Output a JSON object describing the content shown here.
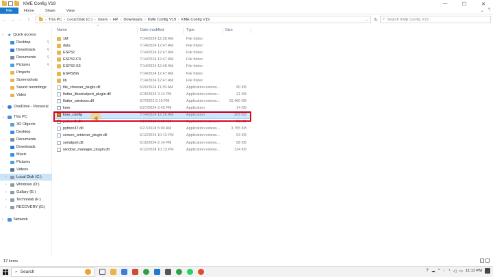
{
  "window": {
    "title": "KME Config V19",
    "controls": {
      "minimize": "—",
      "maximize": "☐",
      "close": "✕"
    }
  },
  "ribbon": {
    "tabs": [
      "File",
      "Home",
      "Share",
      "View"
    ],
    "right_icons": [
      "chevron-down-icon",
      "help-icon"
    ]
  },
  "address": {
    "crumbs": [
      "This PC",
      "Local Disk (C:)",
      "Users",
      "HP",
      "Downloads",
      "KME Config V19",
      "KME Config V19"
    ],
    "search_placeholder": "Search KME Config V19"
  },
  "nav": {
    "quick_access": "Quick access",
    "quick_items": [
      "Desktop",
      "Downloads",
      "Documents",
      "Pictures",
      "Projects",
      "Screenshots",
      "Sound recordings",
      "Video"
    ],
    "onedrive": "OneDrive - Personal",
    "this_pc": "This PC",
    "pc_items": [
      "3D Objects",
      "Desktop",
      "Documents",
      "Downloads",
      "Music",
      "Pictures",
      "Videos",
      "Local Disk (C:)",
      "Windows (D:)",
      "Gallary (E:)",
      "Technolab (F:)",
      "RECOVERY (G:)"
    ],
    "network": "Network"
  },
  "columns": {
    "name": "Name",
    "date": "Date modified",
    "type": "Type",
    "size": "Size"
  },
  "files": [
    {
      "name": "1M",
      "date": "7/14/2024 12:28 AM",
      "type": "File folder",
      "size": "",
      "kind": "folder"
    },
    {
      "name": "data",
      "date": "7/14/2024 12:47 AM",
      "type": "File folder",
      "size": "",
      "kind": "folder"
    },
    {
      "name": "ESP32",
      "date": "7/14/2024 12:47 AM",
      "type": "File folder",
      "size": "",
      "kind": "folder"
    },
    {
      "name": "ESP32-C3",
      "date": "7/14/2024 12:47 AM",
      "type": "File folder",
      "size": "",
      "kind": "folder"
    },
    {
      "name": "ESP32-S3",
      "date": "7/14/2024 12:48 AM",
      "type": "File folder",
      "size": "",
      "kind": "folder"
    },
    {
      "name": "ESP8266",
      "date": "7/14/2024 12:47 AM",
      "type": "File folder",
      "size": "",
      "kind": "folder"
    },
    {
      "name": "lib",
      "date": "7/14/2024 12:47 AM",
      "type": "File folder",
      "size": "",
      "kind": "folder"
    },
    {
      "name": "file_chooser_plugin.dll",
      "date": "5/20/2024 11:39 AM",
      "type": "Application extens...",
      "size": "90 KB",
      "kind": "dll"
    },
    {
      "name": "flutter_libserialport_plugin.dll",
      "date": "6/15/2024 2:14 PM",
      "type": "Application extens...",
      "size": "31 KB",
      "kind": "dll"
    },
    {
      "name": "flutter_windows.dll",
      "date": "9/7/2022 6:10 PM",
      "type": "Application extens...",
      "size": "15,460 KB",
      "kind": "dll"
    },
    {
      "name": "kme",
      "date": "5/27/2024 2:45 PM",
      "type": "Application",
      "size": "14 KB",
      "kind": "app"
    },
    {
      "name": "kme_config",
      "date": "7/14/2024 12:26 AM",
      "type": "Application",
      "size": "209 KB",
      "kind": "kme"
    },
    {
      "name": "python3.dll",
      "date": "6/27/2018 5:00 AM",
      "type": "Application extens...",
      "size": "58 KB",
      "kind": "dll"
    },
    {
      "name": "python37.dll",
      "date": "6/27/2018 5:00 AM",
      "type": "Application extens...",
      "size": "3,755 KB",
      "kind": "dll"
    },
    {
      "name": "screen_retriever_plugin.dll",
      "date": "6/12/2024 10:13 PM",
      "type": "Application extens...",
      "size": "93 KB",
      "kind": "dll"
    },
    {
      "name": "serialport.dll",
      "date": "6/15/2024 2:14 PM",
      "type": "Application extens...",
      "size": "58 KB",
      "kind": "dll"
    },
    {
      "name": "window_manager_plugin.dll",
      "date": "6/12/2024 10:13 PM",
      "type": "Application extens...",
      "size": "134 KB",
      "kind": "dll"
    }
  ],
  "status": {
    "items": "17 items"
  },
  "taskbar": {
    "search_label": "Search",
    "apps": [
      "task-view-icon",
      "file-explorer-icon",
      "store-icon",
      "mail-icon",
      "chrome-icon",
      "vscode-icon",
      "app-icon",
      "chrome-icon",
      "whatsapp-icon",
      "chrome-icon"
    ],
    "time": "11:11 PM",
    "tray_colors": {
      "accent": "#1979ca"
    }
  }
}
